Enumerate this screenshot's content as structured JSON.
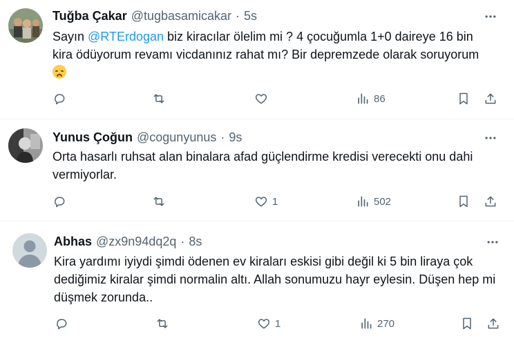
{
  "tweets": [
    {
      "name": "Tuğba Çakar",
      "handle": "@tugbasamicakar",
      "time": "5s",
      "text_before": "Sayın ",
      "mention": "@RTErdogan",
      "text_after": " biz kiracılar ölelim mi ? 4 çocuğumla 1+0 daireye 16 bin kira ödüyorum revamı vicdanınız rahat mı? Bir depremzede olarak soruyorum ",
      "emoji": "disappointed-face-emoji",
      "replies": "",
      "retweets": "",
      "likes": "",
      "views": "86"
    },
    {
      "name": "Yunus Çoğun",
      "handle": "@cogunyunus",
      "time": "9s",
      "text": "Orta hasarlı ruhsat alan binalara afad güçlendirme kredisi verecekti onu dahi vermiyorlar.",
      "replies": "",
      "retweets": "",
      "likes": "1",
      "views": "502"
    },
    {
      "name": "Abhas",
      "handle": "@zx9n94dq2q",
      "time": "8s",
      "text": "Kira yardımı iyiydi şimdi ödenen ev kiraları eskisi gibi değil ki 5 bin liraya çok dediğimiz kiralar şimdi normalin altı. Allah sonumuzu hayr eylesin. Düşen hep mi düşmek zorunda..",
      "replies": "",
      "retweets": "",
      "likes": "1",
      "views": "270"
    }
  ],
  "colors": {
    "text": "#0f1419",
    "secondary": "#536471",
    "mention": "#1d9bf0",
    "separator": "#eff3f4"
  }
}
